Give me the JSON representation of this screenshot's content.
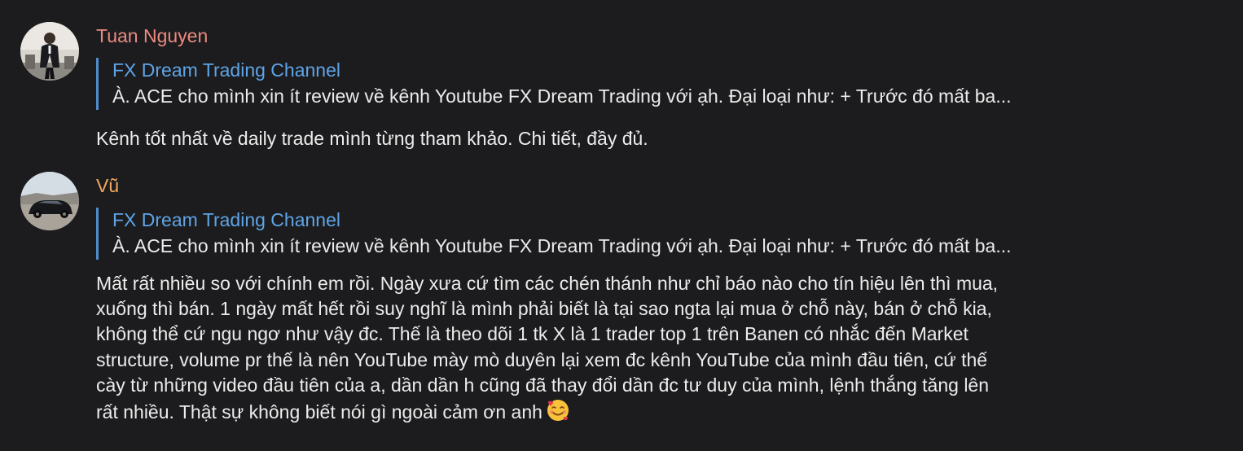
{
  "messages": [
    {
      "sender": "Tuan Nguyen",
      "sender_color": "#ec8a80",
      "reply": {
        "title": "FX Dream Trading Channel",
        "text": "À. ACE cho mình xin ít review về kênh Youtube FX Dream Trading với ạh.  Đại loại như:  + Trước đó mất ba..."
      },
      "body": "Kênh tốt nhất về daily trade mình từng tham khảo. Chi tiết, đầy đủ."
    },
    {
      "sender": "Vũ",
      "sender_color": "#f0a860",
      "reply": {
        "title": "FX Dream Trading Channel",
        "text": "À. ACE cho mình xin ít review về kênh Youtube FX Dream Trading với ạh.  Đại loại như:  + Trước đó mất ba..."
      },
      "body_lines": [
        "Mất rất nhiều so với chính em rồi. Ngày xưa cứ tìm các chén thánh như chỉ báo nào cho tín hiệu lên thì mua,",
        "xuống thì bán. 1 ngày mất hết rồi suy nghĩ là mình phải biết là tại sao ngta lại mua ở chỗ này, bán ở chỗ kia,",
        "không thể cứ ngu ngơ như vậy đc. Thế là theo dõi 1 tk X là 1 trader top 1 trên Banen có nhắc đến Market",
        "structure, volume pr thế là nên YouTube mày mò duyên lại xem đc kênh YouTube của mình đầu tiên, cứ thế",
        "cày từ những video đầu tiên của a, dần dần h cũng đã thay đổi dần đc tư duy của mình, lệnh thắng tăng lên",
        "rất nhiều. Thật sự không biết nói gì ngoài cảm ơn anh"
      ],
      "emoji": "smiling-face-with-hearts"
    }
  ],
  "colors": {
    "background": "#1c1c1e",
    "text": "#ececec",
    "reply_title": "#5fa4e7",
    "reply_bar": "#4f8ccd"
  }
}
